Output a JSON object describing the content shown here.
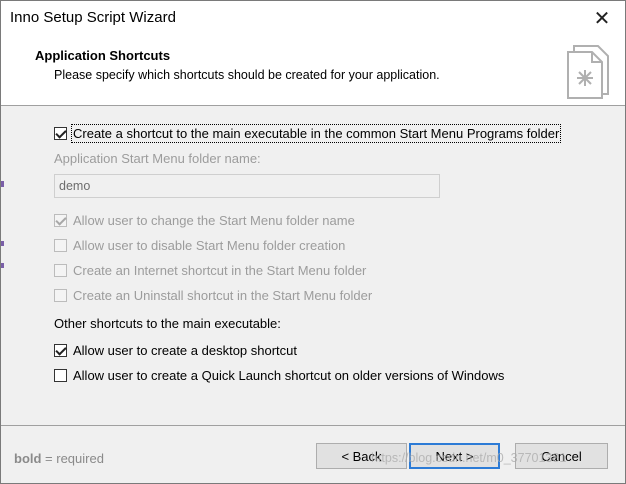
{
  "window": {
    "title": "Inno Setup Script Wizard"
  },
  "header": {
    "title": "Application Shortcuts",
    "subtitle": "Please specify which shortcuts should be created for your application."
  },
  "options": {
    "create_start_menu": {
      "label": "Create a shortcut to the main executable in the common Start Menu Programs folder",
      "checked": true,
      "enabled": true
    },
    "folder_name_label": "Application Start Menu folder name:",
    "folder_name_value": "demo",
    "allow_change_folder": {
      "label": "Allow user to change the Start Menu folder name",
      "checked": true,
      "enabled": false
    },
    "allow_disable_folder": {
      "label": "Allow user to disable Start Menu folder creation",
      "checked": false,
      "enabled": false
    },
    "internet_shortcut": {
      "label": "Create an Internet shortcut in the Start Menu folder",
      "checked": false,
      "enabled": false
    },
    "uninstall_shortcut": {
      "label": "Create an Uninstall shortcut in the Start Menu folder",
      "checked": false,
      "enabled": false
    },
    "other_heading": "Other shortcuts to the main executable:",
    "desktop_shortcut": {
      "label": "Allow user to create a desktop shortcut",
      "checked": true,
      "enabled": true
    },
    "quick_launch": {
      "label": "Allow user to create a Quick Launch shortcut on older versions of Windows",
      "checked": false,
      "enabled": true
    }
  },
  "footer": {
    "required_bold": "bold",
    "required_rest": " = required",
    "back_label": "< Back",
    "next_label": "Next >",
    "cancel_label": "Cancel",
    "watermark": "https://blog.csdn.net/m0_37701381"
  },
  "colors": {
    "default_button_border": "#2c7bd6",
    "window_bg": "#f0f0f0"
  }
}
